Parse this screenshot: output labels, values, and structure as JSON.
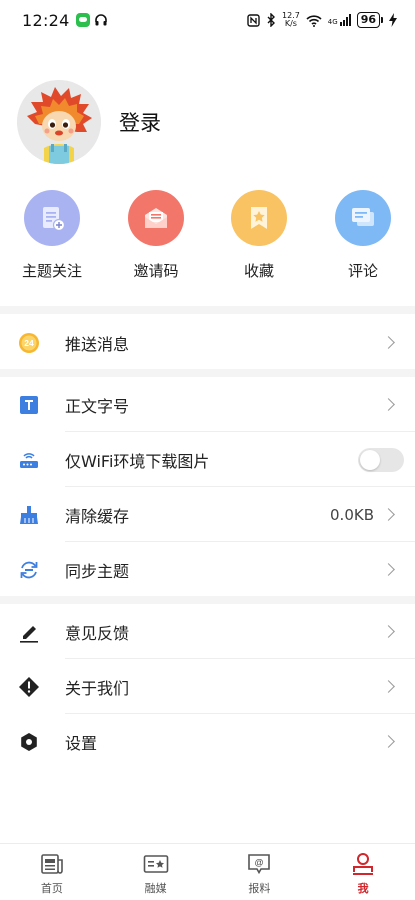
{
  "status_bar": {
    "time": "12:24",
    "net_speed_value": "12.7",
    "net_speed_unit": "K/s",
    "signal": "4G",
    "battery": "96"
  },
  "profile": {
    "login_label": "登录"
  },
  "quick_actions": [
    {
      "label": "主题关注",
      "icon": "topic-follow-icon",
      "color": "#aab3f2"
    },
    {
      "label": "邀请码",
      "icon": "invite-code-icon",
      "color": "#f2766a"
    },
    {
      "label": "收藏",
      "icon": "favorite-icon",
      "color": "#f9c262"
    },
    {
      "label": "评论",
      "icon": "comment-icon",
      "color": "#7eb9f5"
    }
  ],
  "settings": {
    "push": {
      "label": "推送消息",
      "badge": "24"
    },
    "font_size": {
      "label": "正文字号",
      "icon_letter": "T"
    },
    "wifi_images": {
      "label": "仅WiFi环境下载图片",
      "enabled": false
    },
    "clear_cache": {
      "label": "清除缓存",
      "value": "0.0KB"
    },
    "sync_topics": {
      "label": "同步主题"
    },
    "feedback": {
      "label": "意见反馈"
    },
    "about": {
      "label": "关于我们"
    },
    "settings": {
      "label": "设置"
    }
  },
  "bottom_nav": [
    {
      "label": "首页",
      "icon": "news-icon",
      "active": false
    },
    {
      "label": "融媒",
      "icon": "media-icon",
      "active": false
    },
    {
      "label": "报料",
      "icon": "report-icon",
      "active": false
    },
    {
      "label": "我",
      "icon": "profile-icon",
      "active": true
    }
  ],
  "colors": {
    "accent": "#d0262c",
    "icon_blue": "#3d7fe0",
    "badge_orange": "#f7b731"
  }
}
